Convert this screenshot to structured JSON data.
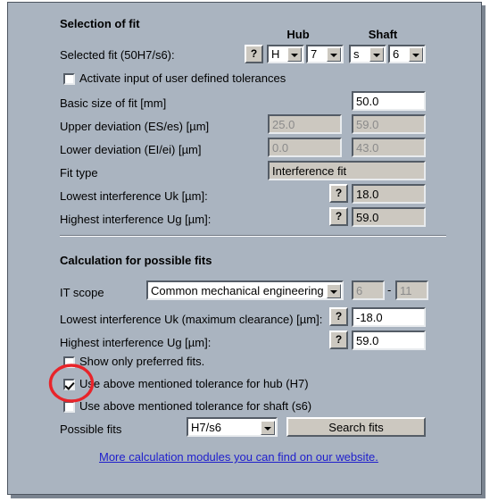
{
  "dialog": {
    "section1_title": "Selection of fit",
    "section2_title": "Calculation for possible fits",
    "hub_header": "Hub",
    "shaft_header": "Shaft",
    "help_glyph": "?",
    "range_dash": "-"
  },
  "selection_of_fit": {
    "selected_fit_label": "Selected fit (50H7/s6):",
    "hub_letter": "H",
    "hub_grade": "7",
    "shaft_letter": "s",
    "shaft_grade": "6",
    "activate_user_tolerances_label": "Activate input of user defined tolerances",
    "activate_user_tolerances_checked": false,
    "basic_size_label": "Basic size of fit [mm]",
    "basic_size_value": "50.0",
    "upper_deviation_label": "Upper deviation (ES/es) [µm]",
    "upper_deviation_hub": "25.0",
    "upper_deviation_shaft": "59.0",
    "lower_deviation_label": "Lower deviation (EI/ei) [µm]",
    "lower_deviation_hub": "0.0",
    "lower_deviation_shaft": "43.0",
    "fit_type_label": "Fit type",
    "fit_type_value": "Interference fit",
    "lowest_interference_label": "Lowest interference Uk [µm]:",
    "lowest_interference_value": "18.0",
    "highest_interference_label": "Highest interference Ug [µm]:",
    "highest_interference_value": "59.0"
  },
  "possible_fits": {
    "it_scope_label": "IT scope",
    "it_scope_value": "Common mechanical engineering",
    "it_from": "6",
    "it_to": "11",
    "lowest_interference_label": "Lowest interference Uk (maximum clearance) [µm]:",
    "lowest_interference_value": "-18.0",
    "highest_interference_label": "Highest interference Ug [µm]:",
    "highest_interference_value": "59.0",
    "show_preferred_label": "Show only preferred fits.",
    "show_preferred_checked": false,
    "use_hub_tolerance_label": "Use above mentioned tolerance for hub (H7)",
    "use_hub_tolerance_checked": true,
    "use_shaft_tolerance_label": "Use above mentioned tolerance for shaft (s6)",
    "use_shaft_tolerance_checked": false,
    "possible_fits_label": "Possible fits",
    "possible_fits_value": "H7/s6",
    "search_fits_button": "Search fits"
  },
  "footer": {
    "link_text": "More calculation modules you can find on our website."
  },
  "annotation": {
    "highlight_color": "#e8242a",
    "target": "use-hub-tolerance-checkbox"
  }
}
